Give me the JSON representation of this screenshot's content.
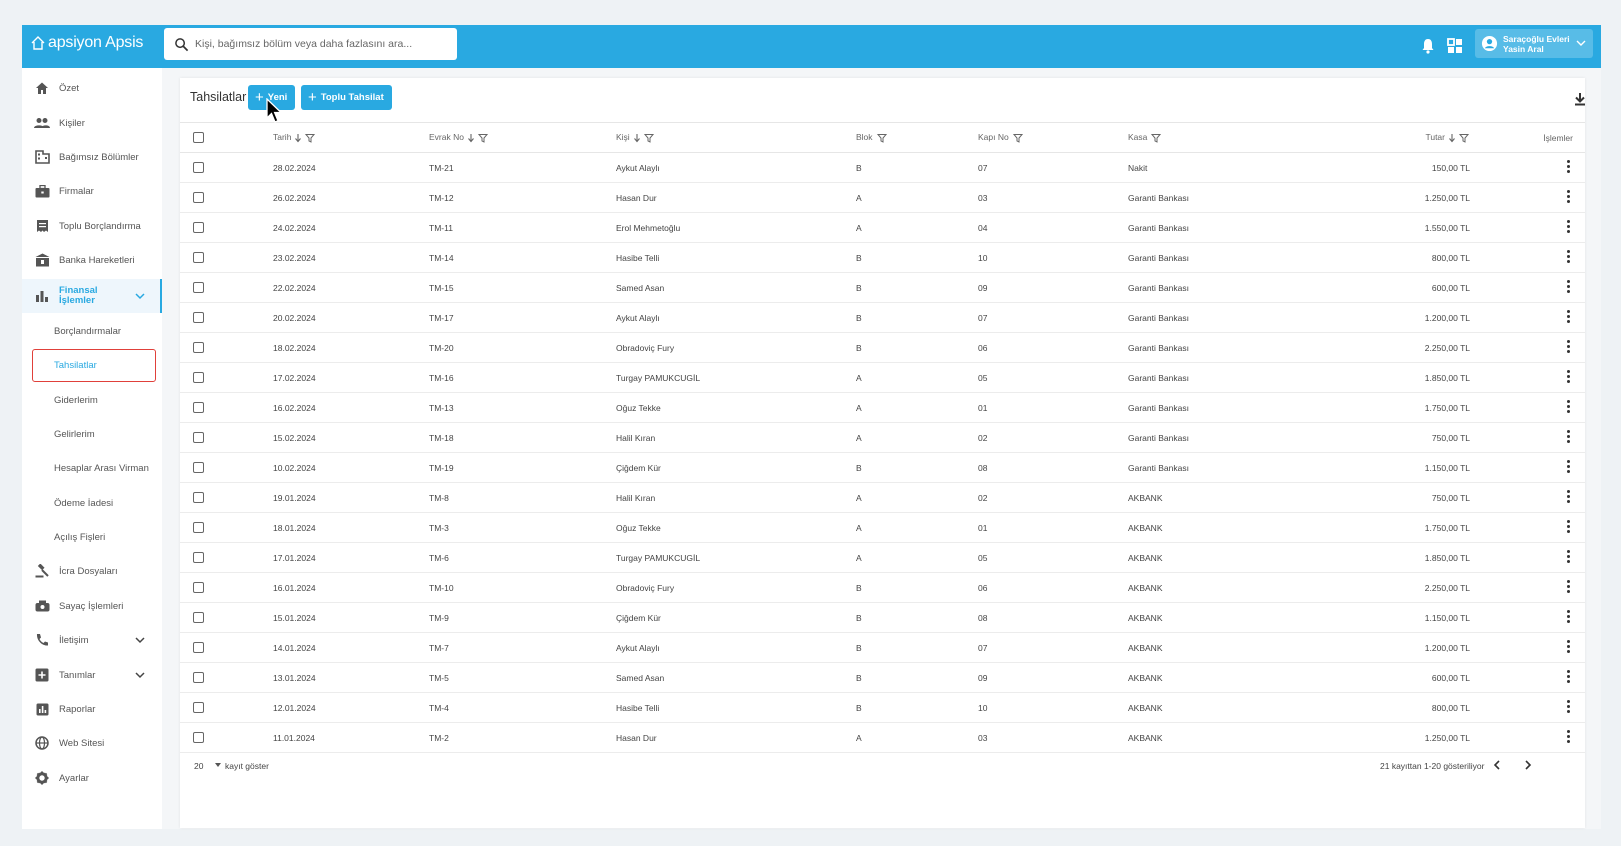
{
  "header": {
    "logo_text": "apsiyon Apsis",
    "search_placeholder": "Kişi, bağımsız bölüm veya daha fazlasını ara...",
    "user_site": "Saraçoğlu Evleri",
    "user_name": "Yasin Aral"
  },
  "sidebar": {
    "items": [
      {
        "label": "Özet",
        "icon": "home-icon"
      },
      {
        "label": "Kişiler",
        "icon": "people-icon"
      },
      {
        "label": "Bağımsız Bölümler",
        "icon": "building-icon"
      },
      {
        "label": "Firmalar",
        "icon": "briefcase-icon"
      },
      {
        "label": "Toplu Borçlandırma",
        "icon": "receipt-icon"
      },
      {
        "label": "Banka Hareketleri",
        "icon": "bank-icon"
      },
      {
        "label": "Finansal İşlemler",
        "icon": "bar-chart-icon"
      },
      {
        "label": "İcra Dosyaları",
        "icon": "gavel-icon"
      },
      {
        "label": "Sayaç İşlemleri",
        "icon": "meter-icon"
      },
      {
        "label": "İletişim",
        "icon": "phone-icon"
      },
      {
        "label": "Tanımlar",
        "icon": "add-box-icon"
      },
      {
        "label": "Raporlar",
        "icon": "report-icon"
      },
      {
        "label": "Web Sitesi",
        "icon": "globe-icon"
      },
      {
        "label": "Ayarlar",
        "icon": "gear-icon"
      }
    ],
    "finance_line1": "Finansal",
    "finance_line2": "İşlemler",
    "sub_items": [
      "Borçlandırmalar",
      "Tahsilatlar",
      "Giderlerim",
      "Gelirlerim",
      "Hesaplar Arası Virman",
      "Ödeme İadesi",
      "Açılış Fişleri"
    ]
  },
  "page": {
    "title": "Tahsilatlar",
    "new_button": "Yeni",
    "bulk_button": "Toplu Tahsilat"
  },
  "table": {
    "columns": {
      "date": "Tarih",
      "doc": "Evrak No",
      "person": "Kişi",
      "block": "Blok",
      "door": "Kapı No",
      "cash": "Kasa",
      "amount": "Tutar",
      "actions": "İşlemler"
    },
    "rows": [
      [
        "28.02.2024",
        "TM-21",
        "Aykut Alaylı",
        "B",
        "07",
        "Nakit",
        "150,00 TL"
      ],
      [
        "26.02.2024",
        "TM-12",
        "Hasan Dur",
        "A",
        "03",
        "Garanti Bankası",
        "1.250,00 TL"
      ],
      [
        "24.02.2024",
        "TM-11",
        "Erol Mehmetoğlu",
        "A",
        "04",
        "Garanti Bankası",
        "1.550,00 TL"
      ],
      [
        "23.02.2024",
        "TM-14",
        "Hasibe Telli",
        "B",
        "10",
        "Garanti Bankası",
        "800,00 TL"
      ],
      [
        "22.02.2024",
        "TM-15",
        "Samed Asan",
        "B",
        "09",
        "Garanti Bankası",
        "600,00 TL"
      ],
      [
        "20.02.2024",
        "TM-17",
        "Aykut Alaylı",
        "B",
        "07",
        "Garanti Bankası",
        "1.200,00 TL"
      ],
      [
        "18.02.2024",
        "TM-20",
        "Obradoviç Fury",
        "B",
        "06",
        "Garanti Bankası",
        "2.250,00 TL"
      ],
      [
        "17.02.2024",
        "TM-16",
        "Turgay PAMUKCUGİL",
        "A",
        "05",
        "Garanti Bankası",
        "1.850,00 TL"
      ],
      [
        "16.02.2024",
        "TM-13",
        "Oğuz Tekke",
        "A",
        "01",
        "Garanti Bankası",
        "1.750,00 TL"
      ],
      [
        "15.02.2024",
        "TM-18",
        "Halil Kıran",
        "A",
        "02",
        "Garanti Bankası",
        "750,00 TL"
      ],
      [
        "10.02.2024",
        "TM-19",
        "Çiğdem Kür",
        "B",
        "08",
        "Garanti Bankası",
        "1.150,00 TL"
      ],
      [
        "19.01.2024",
        "TM-8",
        "Halil Kıran",
        "A",
        "02",
        "AKBANK",
        "750,00 TL"
      ],
      [
        "18.01.2024",
        "TM-3",
        "Oğuz Tekke",
        "A",
        "01",
        "AKBANK",
        "1.750,00 TL"
      ],
      [
        "17.01.2024",
        "TM-6",
        "Turgay PAMUKCUGİL",
        "A",
        "05",
        "AKBANK",
        "1.850,00 TL"
      ],
      [
        "16.01.2024",
        "TM-10",
        "Obradoviç Fury",
        "B",
        "06",
        "AKBANK",
        "2.250,00 TL"
      ],
      [
        "15.01.2024",
        "TM-9",
        "Çiğdem Kür",
        "B",
        "08",
        "AKBANK",
        "1.150,00 TL"
      ],
      [
        "14.01.2024",
        "TM-7",
        "Aykut Alaylı",
        "B",
        "07",
        "AKBANK",
        "1.200,00 TL"
      ],
      [
        "13.01.2024",
        "TM-5",
        "Samed Asan",
        "B",
        "09",
        "AKBANK",
        "600,00 TL"
      ],
      [
        "12.01.2024",
        "TM-4",
        "Hasibe Telli",
        "B",
        "10",
        "AKBANK",
        "800,00 TL"
      ],
      [
        "11.01.2024",
        "TM-2",
        "Hasan Dur",
        "A",
        "03",
        "AKBANK",
        "1.250,00 TL"
      ]
    ]
  },
  "pagination": {
    "page_size": "20",
    "page_size_label": "kayıt göster",
    "info": "21 kayıttan 1-20 gösteriliyor"
  },
  "colors": {
    "brand": "#29a9e1",
    "highlight": "#e0403a"
  }
}
